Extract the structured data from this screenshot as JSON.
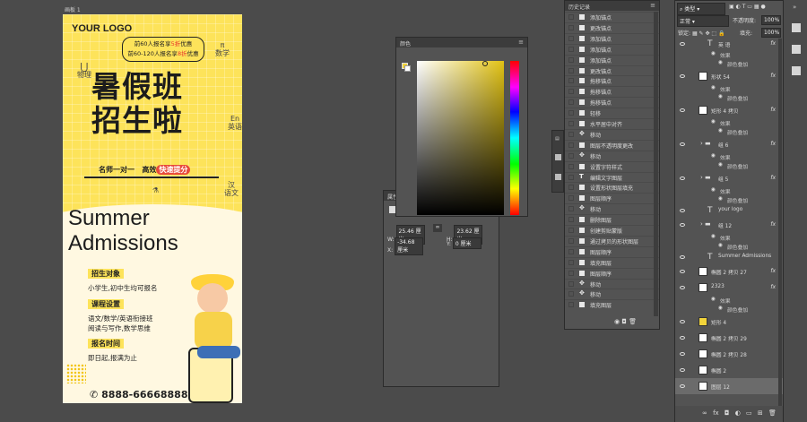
{
  "artboard": {
    "label": "画板 1"
  },
  "poster": {
    "logo": "YOUR LOGO",
    "bubble_line1_a": "前60人报名享",
    "bubble_line1_b": "5折",
    "bubble_line1_c": "优惠",
    "bubble_line2_a": "前60-120人报名享",
    "bubble_line2_b": "8折",
    "bubble_line2_c": "优惠",
    "title_line1": "暑假班",
    "title_line2": "招生啦",
    "deco_math": "数学",
    "deco_physics": "物理",
    "deco_en": "En",
    "deco_en2": "英语",
    "deco_chem": "化学",
    "deco_cn": "汉",
    "deco_cn2": "语文",
    "deco_pi": "π",
    "tagline_a": "名师一对一",
    "tagline_b": "高效",
    "tagline_c": "快速提分",
    "summer1": "Summer",
    "summer2": "Admissions",
    "sections": [
      {
        "label": "招生对象",
        "lines": [
          "小学生,初中生均可报名"
        ]
      },
      {
        "label": "课程设置",
        "lines": [
          "语文/数学/英语衔接班",
          "阅读与写作,数学思维"
        ]
      },
      {
        "label": "报名时间",
        "lines": [
          "即日起,报满为止"
        ]
      }
    ],
    "phone": "8888-66668888"
  },
  "color_panel": {
    "title": "颜色",
    "fg": "#f2d43a"
  },
  "props_panel": {
    "title": "属性",
    "w_label": "W:",
    "w": "25.46 厘米",
    "h_label": "H:",
    "h": "23.62 厘米",
    "x_label": "X:",
    "x": "-34.68 厘米",
    "y_label": "Y:",
    "y": "0 厘米"
  },
  "history_panel": {
    "title": "历史记录",
    "items": [
      {
        "icon": "anchor",
        "label": "添加锚点"
      },
      {
        "icon": "anchor",
        "label": "更改锚点"
      },
      {
        "icon": "anchor",
        "label": "添加锚点"
      },
      {
        "icon": "anchor",
        "label": "添加锚点"
      },
      {
        "icon": "anchor",
        "label": "添加锚点"
      },
      {
        "icon": "anchor",
        "label": "更改锚点"
      },
      {
        "icon": "anchor",
        "label": "拖移锚点"
      },
      {
        "icon": "anchor",
        "label": "拖移锚点"
      },
      {
        "icon": "anchor",
        "label": "拖移锚点"
      },
      {
        "icon": "anchor",
        "label": "轻移"
      },
      {
        "icon": "anchor",
        "label": "水平居中对齐"
      },
      {
        "icon": "move",
        "label": "移动"
      },
      {
        "icon": "anchor",
        "label": "图层不透明度更改"
      },
      {
        "icon": "move",
        "label": "移动"
      },
      {
        "icon": "anchor",
        "label": "设置字符样式"
      },
      {
        "icon": "text",
        "label": "编辑文字图层"
      },
      {
        "icon": "anchor",
        "label": "设置形状图层填充"
      },
      {
        "icon": "anchor",
        "label": "图层顺序"
      },
      {
        "icon": "move",
        "label": "移动"
      },
      {
        "icon": "anchor",
        "label": "删除图层"
      },
      {
        "icon": "anchor",
        "label": "创建剪贴蒙版"
      },
      {
        "icon": "anchor",
        "label": "通过拷贝的形状图层"
      },
      {
        "icon": "anchor",
        "label": "图层顺序"
      },
      {
        "icon": "anchor",
        "label": "填充图层"
      },
      {
        "icon": "anchor",
        "label": "图层顺序"
      },
      {
        "icon": "move",
        "label": "移动"
      },
      {
        "icon": "move",
        "label": "移动"
      },
      {
        "icon": "anchor",
        "label": "填充图层"
      }
    ]
  },
  "layers_panel": {
    "kind": "类型",
    "blend": "正常",
    "opacity_label": "不透明度:",
    "opacity": "100%",
    "lock_label": "锁定:",
    "fill_label": "填充:",
    "fill": "100%",
    "layers": [
      {
        "type": "text",
        "name": "英 语",
        "fx": true
      },
      {
        "type": "sub",
        "name": "效果"
      },
      {
        "type": "sub2",
        "name": "颜色叠加"
      },
      {
        "type": "shape",
        "name": "形状 54",
        "fx": true
      },
      {
        "type": "sub",
        "name": "效果"
      },
      {
        "type": "sub2",
        "name": "颜色叠加"
      },
      {
        "type": "shape",
        "name": "矩形 4 拷贝",
        "fx": true
      },
      {
        "type": "sub",
        "name": "效果"
      },
      {
        "type": "sub2",
        "name": "颜色叠加"
      },
      {
        "type": "group",
        "name": "组 6",
        "fx": true
      },
      {
        "type": "sub",
        "name": "效果"
      },
      {
        "type": "sub2",
        "name": "颜色叠加"
      },
      {
        "type": "group",
        "name": "组 5",
        "fx": true
      },
      {
        "type": "sub",
        "name": "效果"
      },
      {
        "type": "sub2",
        "name": "颜色叠加"
      },
      {
        "type": "text",
        "name": "your logo"
      },
      {
        "type": "group",
        "name": "组 12",
        "fx": true
      },
      {
        "type": "sub",
        "name": "效果"
      },
      {
        "type": "sub2",
        "name": "颜色叠加"
      },
      {
        "type": "text",
        "name": "Summer Admissions"
      },
      {
        "type": "shape",
        "name": "椭圆 2 拷贝 27",
        "fx": true
      },
      {
        "type": "shape",
        "name": "2323",
        "fx": true
      },
      {
        "type": "sub",
        "name": "效果"
      },
      {
        "type": "sub2",
        "name": "颜色叠加"
      },
      {
        "type": "shape",
        "name": "矩形 4"
      },
      {
        "type": "shape",
        "name": "椭圆 2 拷贝 29"
      },
      {
        "type": "shape",
        "name": "椭圆 2 拷贝 28"
      },
      {
        "type": "shape",
        "name": "椭圆 2"
      },
      {
        "type": "shape",
        "name": "图层 12"
      }
    ]
  }
}
